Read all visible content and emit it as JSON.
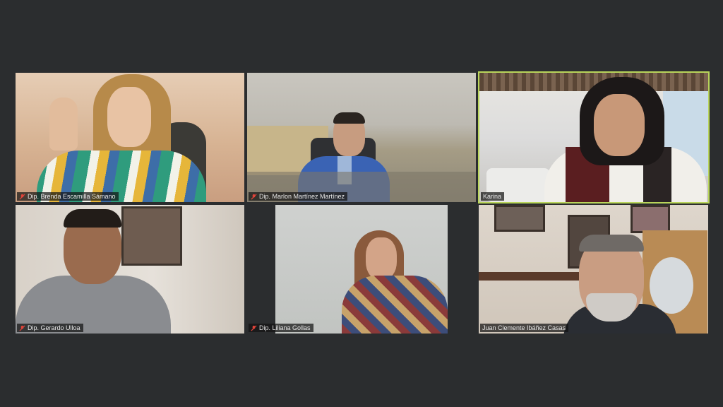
{
  "participants": [
    {
      "name": "Dip. Brenda Escamilla Sámano",
      "muted": true,
      "active": false,
      "bg": "#d8b49a"
    },
    {
      "name": "Dip. Marlon Martínez Martínez",
      "muted": true,
      "active": false,
      "bg": "#b9b6ad"
    },
    {
      "name": "Karina",
      "muted": false,
      "active": true,
      "bg": "#c8ccd0"
    },
    {
      "name": "Dip. Gerardo Ulloa",
      "muted": true,
      "active": false,
      "bg": "#d4cdc6"
    },
    {
      "name": "Dip. Liliana Gollas",
      "muted": true,
      "active": false,
      "bg": "#c4c6c2"
    },
    {
      "name": "Juan Clemente Ibáñez Casas",
      "muted": false,
      "active": false,
      "bg": "#cfc7bd"
    }
  ],
  "colors": {
    "background": "#2b2d2f",
    "active_border": "#b9d55a",
    "muted_icon": "#e0443a"
  }
}
